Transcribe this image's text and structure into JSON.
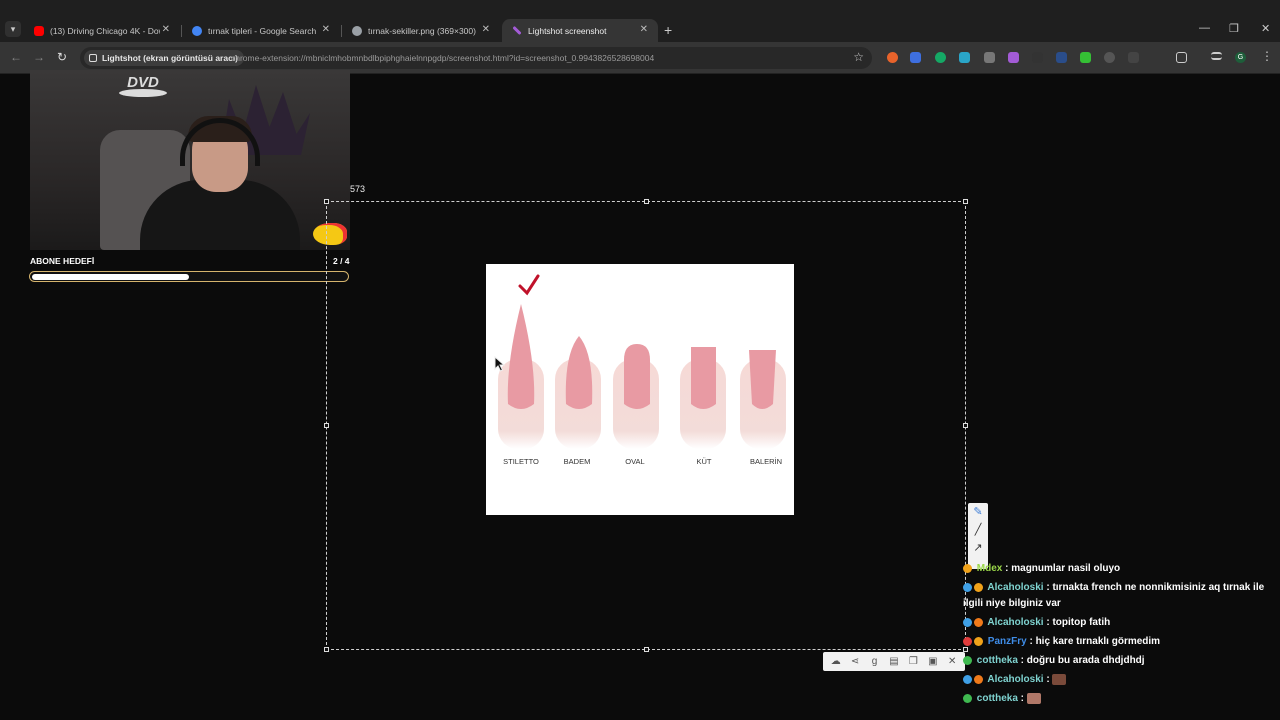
{
  "browser": {
    "tabs": [
      {
        "title": "(13) Driving Chicago 4K - Dow",
        "favicon_color": "#ff0000",
        "active": false
      },
      {
        "title": "tırnak tipleri - Google Search",
        "favicon_color": "#4285f4",
        "active": false
      },
      {
        "title": "tırnak-sekiller.png (369×300)",
        "favicon_color": "#9aa0a6",
        "active": false
      },
      {
        "title": "Lightshot screenshot",
        "favicon_color": "#a35bd6",
        "active": true
      }
    ],
    "site_chip": "Lightshot (ekran görüntüsü aracı)",
    "url": "chrome-extension://mbniclmhobmnbdlbpiphghaielnnpgdp/screenshot.html?id=screenshot_0.9943826528698004",
    "profile_initial": "G"
  },
  "stream": {
    "goal_label": "ABONE HEDEFİ",
    "goal_count": "2 / 4",
    "goal_progress": 0.5,
    "dvd_logo": "DVD"
  },
  "lightshot": {
    "coord_readout": "573"
  },
  "nail_image": {
    "labels": [
      "STILETTO",
      "BADEM",
      "OVAL",
      "KÜT",
      "BALERİN"
    ],
    "checkmark_color": "#c0122a"
  },
  "chat": {
    "messages": [
      {
        "user": "Mdex",
        "user_color": "#9bd84a",
        "text": "magnumlar nasil oluyo"
      },
      {
        "user": "Alcaholoski",
        "user_color": "#7fd3d0",
        "text": "tırnakta french ne nonnikmisiniz aq tırnak ile ilgili niye bilginiz var"
      },
      {
        "user": "Alcaholoski",
        "user_color": "#7fd3d0",
        "text": "topitop fatih"
      },
      {
        "user": "PanzFry",
        "user_color": "#3f8de8",
        "text": "hiç kare tırnaklı görmedim"
      },
      {
        "user": "cottheka",
        "user_color": "#7fd3d0",
        "text": "doğru bu arada dhdjdhdj"
      },
      {
        "user": "Alcaholoski",
        "user_color": "#7fd3d0",
        "text": ""
      },
      {
        "user": "cottheka",
        "user_color": "#7fd3d0",
        "text": ""
      }
    ]
  }
}
